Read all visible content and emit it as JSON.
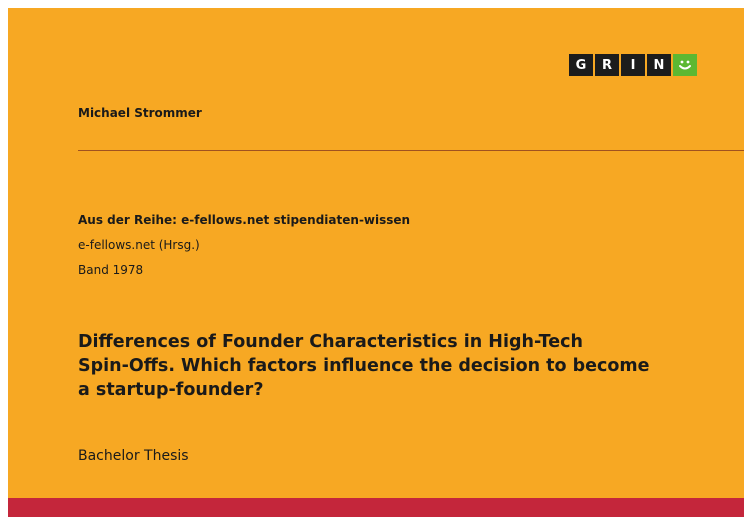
{
  "logo": {
    "letters": [
      "G",
      "R",
      "I",
      "N"
    ],
    "smile_glyph": "☺",
    "letter_bg": "#1c1c1c",
    "smile_bg": "#5cb832"
  },
  "author": "Michael Strommer",
  "series": "Aus der Reihe: e-fellows.net stipendiaten-wissen",
  "editor": "e-fellows.net (Hrsg.)",
  "volume": "Band 1978",
  "title_lines": [
    "Differences of Founder Characteristics in High-Tech",
    "Spin-Offs. Which factors influence the decision to become",
    "a startup-founder?"
  ],
  "doc_type": "Bachelor Thesis",
  "colors": {
    "cover_bg": "#f7a823",
    "bottom_band": "#c4263b",
    "divider": "#a0521f"
  }
}
